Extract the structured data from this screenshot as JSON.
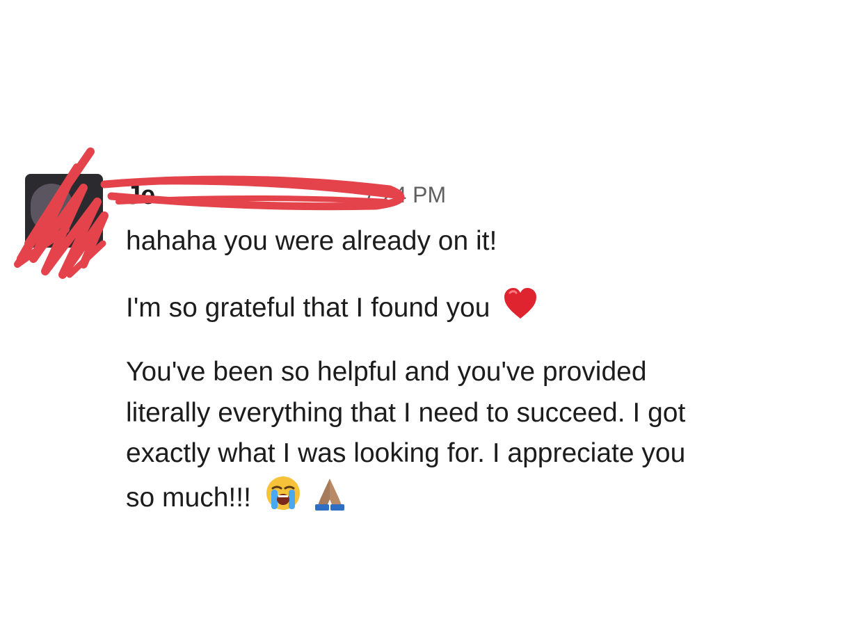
{
  "message": {
    "sender_name": "Je",
    "timestamp": "7:24 PM",
    "lines": [
      "hahaha you were already on it!",
      "I'm so grateful that I found you"
    ],
    "paragraph": [
      "You've been so helpful and you've provided",
      "literally everything that I need to succeed. I got",
      "exactly what I was looking for. I appreciate you",
      "so much!!!"
    ],
    "emoji": [
      "red-heart",
      "loudly-crying-face",
      "folded-hands"
    ],
    "colors": {
      "text": "#1d1c1d",
      "timestamp": "#616061",
      "redaction": "#e5434b",
      "heart": "#e0242f"
    }
  }
}
